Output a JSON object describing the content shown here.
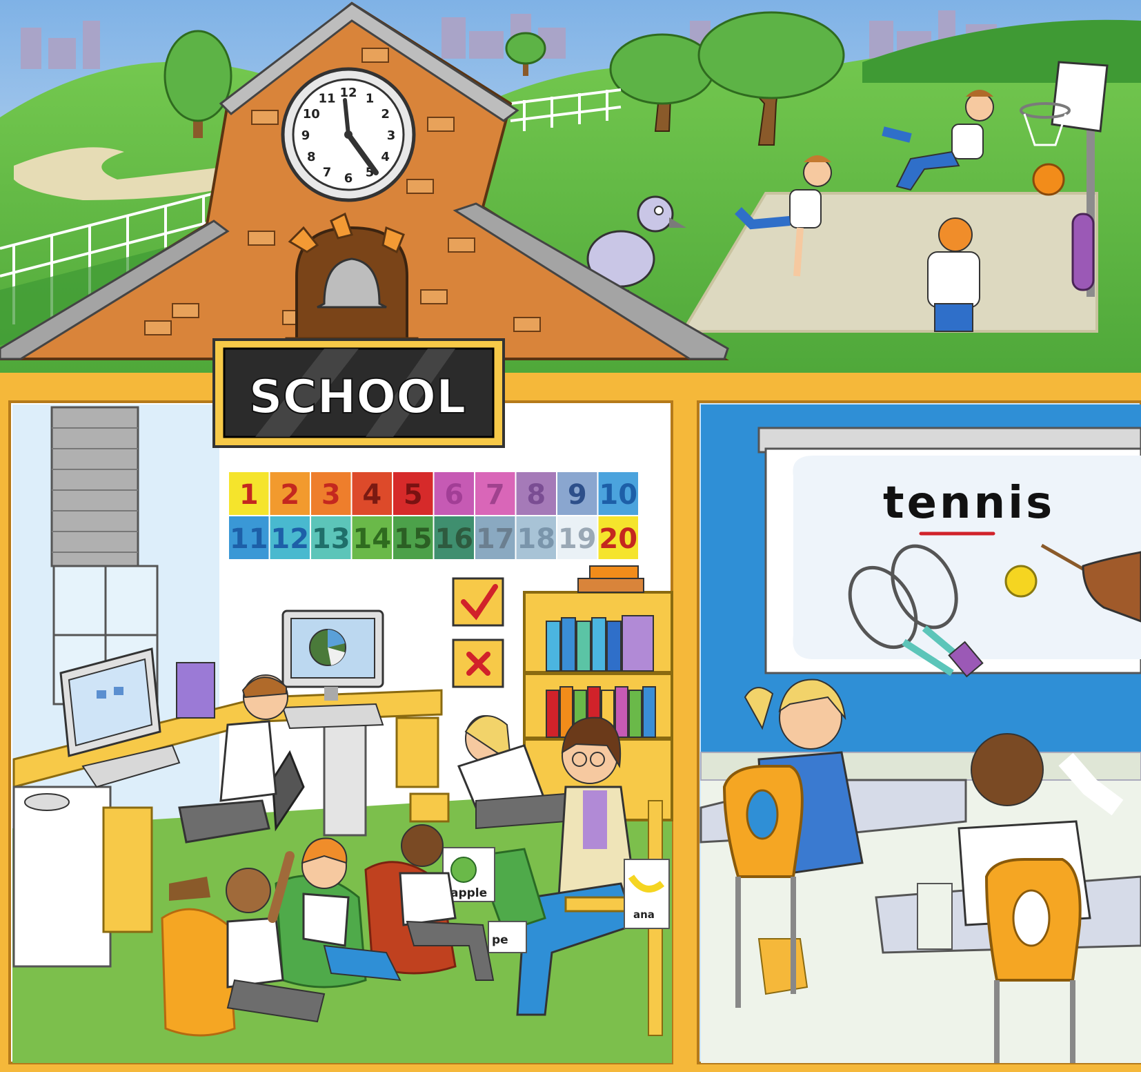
{
  "sign": {
    "text": "SCHOOL"
  },
  "clock": {
    "numbers": [
      "12",
      "1",
      "2",
      "3",
      "4",
      "5",
      "6",
      "7",
      "8",
      "9",
      "10",
      "11"
    ]
  },
  "number_chart": {
    "row1": [
      "1",
      "2",
      "3",
      "4",
      "5",
      "6",
      "7",
      "8",
      "9",
      "10"
    ],
    "row2": [
      "11",
      "12",
      "13",
      "14",
      "15",
      "16",
      "17",
      "18",
      "19",
      "20"
    ],
    "row1_colors": [
      "#f5e42c",
      "#f29a2e",
      "#ee7e2c",
      "#dd4a2a",
      "#d62a2a",
      "#c65ab4",
      "#d966b8",
      "#a57ab8",
      "#8aa6cf",
      "#4ba3dd"
    ],
    "row2_colors": [
      "#3a98d6",
      "#49b9cf",
      "#5cc5b9",
      "#6ab949",
      "#4ca14a",
      "#3f8f6f",
      "#8aa9c1",
      "#a8c3d6",
      "#eaf1f6",
      "#f5e42c"
    ],
    "row1_text_colors": [
      "#c4281f",
      "#c4281f",
      "#c4281f",
      "#7a1a12",
      "#7a1212",
      "#a23e96",
      "#a0428e",
      "#7a4d93",
      "#2d4f8a",
      "#1d5fa8"
    ],
    "row2_text_colors": [
      "#1d5fa8",
      "#1d5fa8",
      "#1f6f6a",
      "#2f6b1f",
      "#2b5f24",
      "#2e5a3f",
      "#6b7f90",
      "#7a95ab",
      "#9aa8b5",
      "#c4281f"
    ]
  },
  "whiteboard": {
    "word": "tennis"
  },
  "flash_cards": {
    "apple": "apple",
    "pear": "pe",
    "banana": "ana"
  },
  "colors": {
    "sky": "#c9dcf0",
    "grass": "#5cb842",
    "brick": "#d9843a",
    "frame": "#f5b83a",
    "wall": "#ffffff",
    "underline": "#d1222a"
  }
}
